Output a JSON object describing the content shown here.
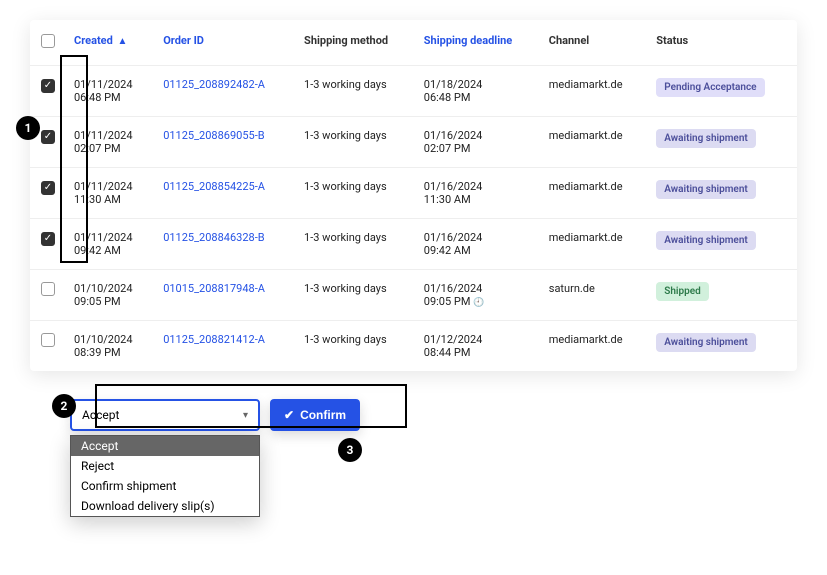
{
  "columns": {
    "created": "Created",
    "order_id": "Order ID",
    "shipping_method": "Shipping method",
    "shipping_deadline": "Shipping deadline",
    "channel": "Channel",
    "status": "Status"
  },
  "rows": [
    {
      "checked": true,
      "date": "01/11/2024",
      "time": "06:48 PM",
      "order_id": "01125_208892482-A",
      "shipping_method": "1-3 working days",
      "deadline_date": "01/18/2024",
      "deadline_time": "06:48 PM",
      "deadline_icon": "",
      "channel": "mediamarkt.de",
      "status": "Pending Acceptance",
      "status_class": "pending"
    },
    {
      "checked": true,
      "date": "01/11/2024",
      "time": "02:07 PM",
      "order_id": "01125_208869055-B",
      "shipping_method": "1-3 working days",
      "deadline_date": "01/16/2024",
      "deadline_time": "02:07 PM",
      "deadline_icon": "",
      "channel": "mediamarkt.de",
      "status": "Awaiting shipment",
      "status_class": "awaiting"
    },
    {
      "checked": true,
      "date": "01/11/2024",
      "time": "11:30 AM",
      "order_id": "01125_208854225-A",
      "shipping_method": "1-3 working days",
      "deadline_date": "01/16/2024",
      "deadline_time": "11:30 AM",
      "deadline_icon": "",
      "channel": "mediamarkt.de",
      "status": "Awaiting shipment",
      "status_class": "awaiting"
    },
    {
      "checked": true,
      "date": "01/11/2024",
      "time": "09:42 AM",
      "order_id": "01125_208846328-B",
      "shipping_method": "1-3 working days",
      "deadline_date": "01/16/2024",
      "deadline_time": "09:42 AM",
      "deadline_icon": "",
      "channel": "mediamarkt.de",
      "status": "Awaiting shipment",
      "status_class": "awaiting"
    },
    {
      "checked": false,
      "date": "01/10/2024",
      "time": "09:05 PM",
      "order_id": "01015_208817948-A",
      "shipping_method": "1-3 working days",
      "deadline_date": "01/16/2024",
      "deadline_time": "09:05 PM",
      "deadline_icon": "clock",
      "channel": "saturn.de",
      "status": "Shipped",
      "status_class": "shipped"
    },
    {
      "checked": false,
      "date": "01/10/2024",
      "time": "08:39 PM",
      "order_id": "01125_208821412-A",
      "shipping_method": "1-3 working days",
      "deadline_date": "01/12/2024",
      "deadline_time": "08:44 PM",
      "deadline_icon": "",
      "channel": "mediamarkt.de",
      "status": "Awaiting shipment",
      "status_class": "awaiting"
    }
  ],
  "action": {
    "selected": "Accept",
    "options": [
      "Accept",
      "Reject",
      "Confirm shipment",
      "Download delivery slip(s)"
    ],
    "confirm_label": "Confirm"
  },
  "annotations": {
    "one": "1",
    "two": "2",
    "three": "3"
  }
}
